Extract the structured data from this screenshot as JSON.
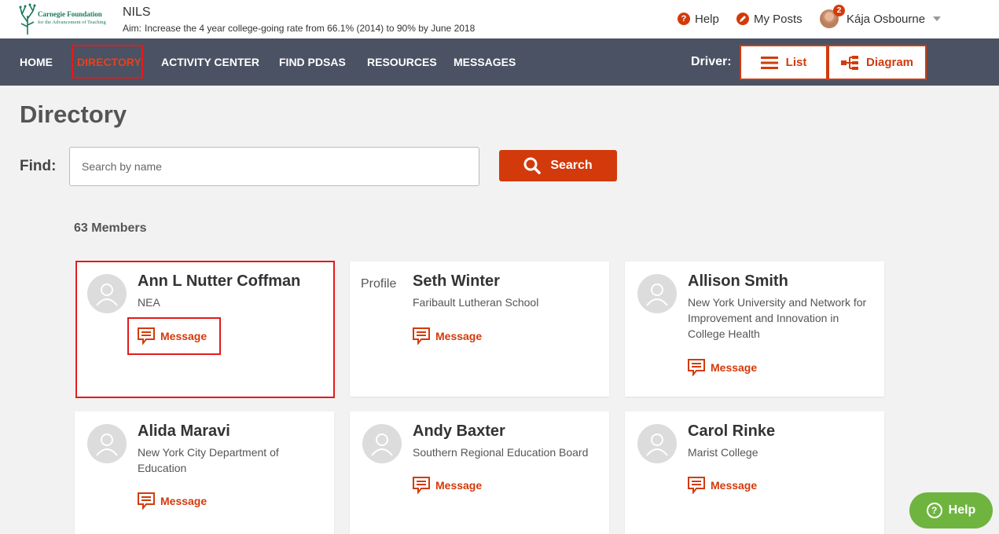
{
  "header": {
    "logo_line1": "Carnegie Foundation",
    "logo_line2": "for the Advancement of Teaching",
    "app_name": "NILS",
    "aim_label": "Aim:",
    "aim_text": "Increase the 4 year college-going rate from 66.1% (2014) to 90% by June 2018",
    "help_label": "Help",
    "my_posts_label": "My Posts",
    "user_name": "Kája Osbourne",
    "notification_count": "2"
  },
  "nav": {
    "items": [
      "HOME",
      "DIRECTORY",
      "ACTIVITY CENTER",
      "FIND PDSAS",
      "RESOURCES",
      "MESSAGES"
    ],
    "active": "DIRECTORY",
    "driver_label": "Driver:",
    "list_label": "List",
    "diagram_label": "Diagram"
  },
  "page": {
    "title": "Directory",
    "find_label": "Find:",
    "search_placeholder": "Search by name",
    "search_value": "",
    "search_button": "Search",
    "members_count": "63 Members"
  },
  "members": [
    {
      "name": "Ann L Nutter Coffman",
      "org": "NEA",
      "message_label": "Message",
      "photo": "default-avatar-icon"
    },
    {
      "name": "Seth Winter",
      "org": "Faribault Lutheran School",
      "message_label": "Message",
      "photo": "broken-image",
      "photo_alt": "Profile"
    },
    {
      "name": "Allison Smith",
      "org": "New York University and Network for Improvement and Innovation in College Health",
      "message_label": "Message",
      "photo": "default-avatar-icon"
    },
    {
      "name": "Alida Maravi",
      "org": "New York City Department of Education",
      "message_label": "Message",
      "photo": "default-avatar-icon"
    },
    {
      "name": "Andy Baxter",
      "org": "Southern Regional Education Board",
      "message_label": "Message",
      "photo": "default-avatar-icon"
    },
    {
      "name": "Carol Rinke",
      "org": "Marist College",
      "message_label": "Message",
      "photo": "default-avatar-icon"
    }
  ],
  "floating_help": {
    "label": "Help"
  },
  "colors": {
    "accent": "#d33a0b",
    "nav_bg": "#4b5263",
    "page_bg": "#f2f2f2",
    "help_green": "#6fb43f",
    "highlight": "#e41a1a"
  }
}
